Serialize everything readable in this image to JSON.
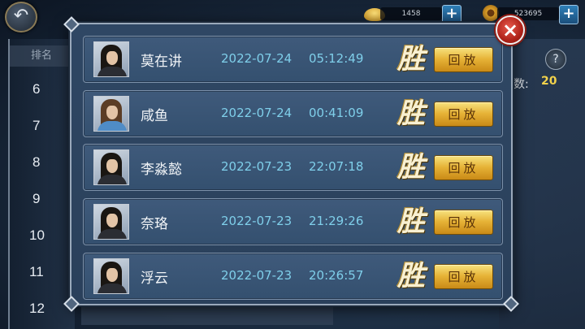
{
  "top_bar": {
    "back_icon": "arrow-back-icon",
    "ingot_amount": "1458",
    "coin_amount": "523695",
    "plus_label": "+"
  },
  "ranking_panel": {
    "header": "排名",
    "ranks": [
      "6",
      "7",
      "8",
      "9",
      "10",
      "11",
      "12"
    ]
  },
  "right_panel": {
    "help_label": "?",
    "count_label": "数:",
    "count_value": "20"
  },
  "modal": {
    "close_label": "×",
    "records": [
      {
        "name": "莫在讲",
        "date": "2022-07-24",
        "time": "05:12:49",
        "result": "胜",
        "replay": "回放",
        "avatar": "black"
      },
      {
        "name": "咸鱼",
        "date": "2022-07-24",
        "time": "00:41:09",
        "result": "胜",
        "replay": "回放",
        "avatar": "blue"
      },
      {
        "name": "李淼懿",
        "date": "2022-07-23",
        "time": "22:07:18",
        "result": "胜",
        "replay": "回放",
        "avatar": "black"
      },
      {
        "name": "奈珞",
        "date": "2022-07-23",
        "time": "21:29:26",
        "result": "胜",
        "replay": "回放",
        "avatar": "black"
      },
      {
        "name": "浮云",
        "date": "2022-07-23",
        "time": "20:26:57",
        "result": "胜",
        "replay": "回放",
        "avatar": "black"
      }
    ]
  },
  "colors": {
    "accent_gold": "#e6b236",
    "time_text": "#7fcfea",
    "count_value": "#f2d24b",
    "close_red": "#b0231a"
  }
}
